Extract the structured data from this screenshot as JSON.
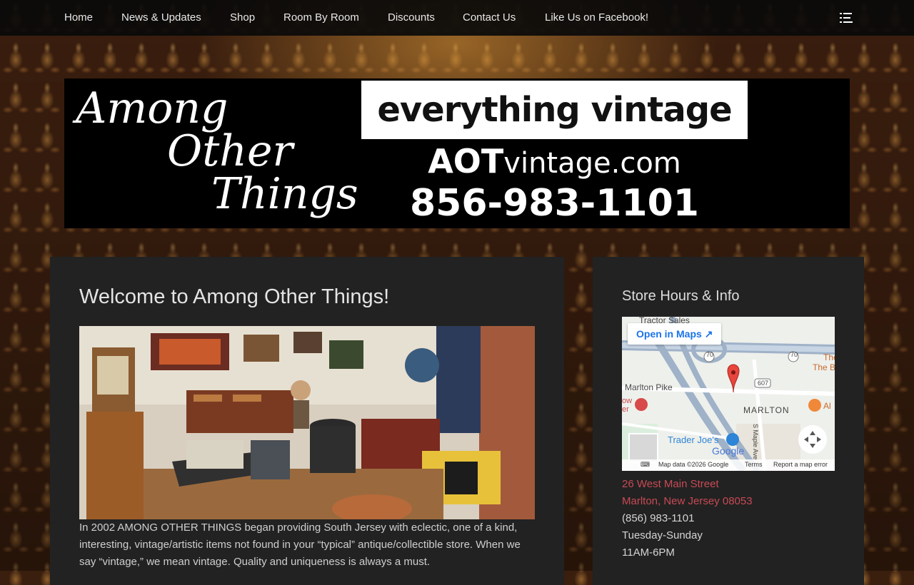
{
  "nav": {
    "items": [
      {
        "label": "Home"
      },
      {
        "label": "News & Updates"
      },
      {
        "label": "Shop"
      },
      {
        "label": "Room By Room"
      },
      {
        "label": "Discounts"
      },
      {
        "label": "Contact Us"
      },
      {
        "label": "Like Us on Facebook!"
      }
    ],
    "menu_icon": "list-menu-icon"
  },
  "banner": {
    "logo_line1": "Among",
    "logo_line2": "Other",
    "logo_line3": "Things",
    "tagline": "everything vintage",
    "url_bold": "AOT",
    "url_rest": "vintage.com",
    "phone": "856-983-1101"
  },
  "main": {
    "title": "Welcome to Among Other Things!",
    "intro": "In 2002 AMONG OTHER THINGS began providing South Jersey with eclectic, one of a kind, interesting, vintage/artistic items not found in your “typical” antique/collectible store. When we say “vintage,” we mean vintage. Quality and uniqueness is always a must."
  },
  "sidebar": {
    "title": "Store Hours & Info",
    "map": {
      "open_in_maps": "Open in Maps",
      "labels": {
        "tractor": "Tractor Sales",
        "marlton_pike": "Marlton Pike",
        "marlton": "MARLTON",
        "trader_joes": "Trader Joe's",
        "s_maple": "S Maple Ave",
        "route70a": "70",
        "route70b": "70",
        "route607": "607",
        "the": "The",
        "the_b": "The B",
        "al": "Al",
        "ow": "ow",
        "er": "er"
      },
      "google": "Google",
      "footer": {
        "data": "Map data ©2026 Google",
        "terms": "Terms",
        "report": "Report a map error"
      }
    },
    "address_line1": "26 West Main Street",
    "address_line2": "Marlton, New Jersey 08053",
    "phone": "(856) 983-1101",
    "days": "Tuesday-Sunday",
    "hours": "11AM-6PM"
  },
  "colors": {
    "link": "#c84a55",
    "panel": "#222222",
    "nav": "#0a0a0a"
  }
}
